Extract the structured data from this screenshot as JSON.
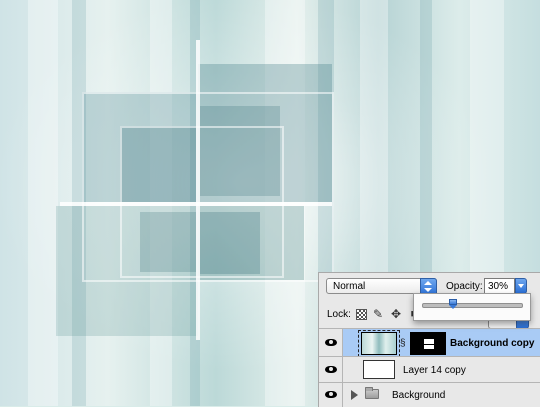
{
  "layers_panel": {
    "blend_mode": "Normal",
    "opacity_label": "Opacity:",
    "opacity_value": "30%",
    "opacity_slider_fraction": 0.3,
    "lock_label": "Lock:",
    "layers": [
      {
        "name": "Background copy",
        "selected": true,
        "visible": true,
        "has_mask": true
      },
      {
        "name": "Layer 14 copy",
        "selected": false,
        "visible": true
      },
      {
        "name": "Background",
        "selected": false,
        "visible": true,
        "is_group": true
      }
    ]
  },
  "icons": {
    "blend_arrows": "up-down-arrows-icon",
    "opacity_dropdown": "dropdown-arrow-icon",
    "lock_transparent": "lock-transparent-pixels-icon",
    "lock_image": "brush-icon",
    "lock_position": "move-icon",
    "lock_all": "lock-all-icon",
    "visibility": "eye-icon",
    "link": "chain-icon",
    "group": "folder-icon",
    "expand": "disclosure-triangle-icon"
  },
  "colors": {
    "selection": "#a9cbf5",
    "accent": "#2a6fd6"
  }
}
